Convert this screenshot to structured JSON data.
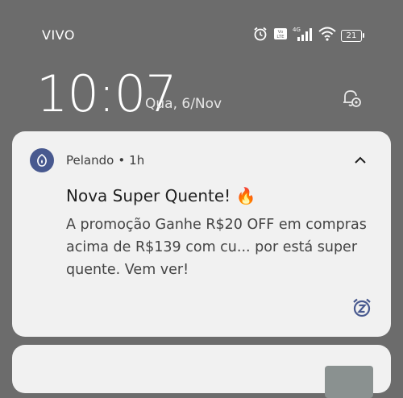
{
  "status_bar": {
    "carrier": "VIVO",
    "battery_level": "21",
    "icons": [
      "alarm-icon",
      "volte-icon",
      "signal-4g-icon",
      "wifi-icon",
      "battery-icon"
    ]
  },
  "lockscreen": {
    "time": "10:07",
    "date": "Qua, 6/Nov"
  },
  "notification": {
    "app_name": "Pelando",
    "separator": "•",
    "age": "1h",
    "title": "Nova Super Quente! 🔥",
    "body": "A promoção Ganhe R$20 OFF em compras acima de R$139 com cu... por  está super quente. Vem ver!"
  },
  "colors": {
    "background": "#6c6c6c",
    "card": "#f1f1f1",
    "app_icon": "#48598f"
  }
}
